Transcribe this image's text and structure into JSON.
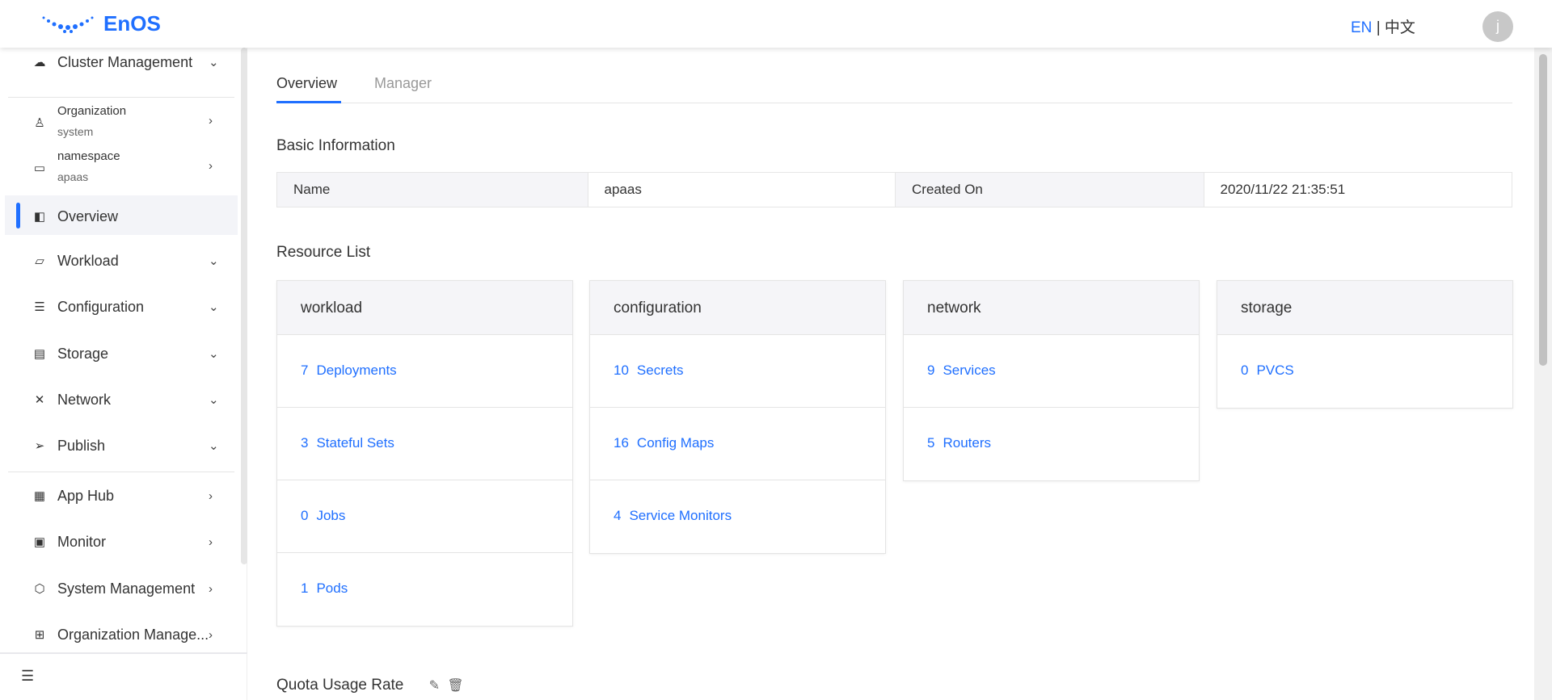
{
  "header": {
    "logo": "EnOS",
    "lang_en": "EN",
    "lang_sep": "|",
    "lang_zh": "中文",
    "avatar": "j"
  },
  "sidebar": {
    "cluster": "Cluster Management",
    "organization": {
      "label": "Organization",
      "value": "system"
    },
    "namespace": {
      "label": "namespace",
      "value": "apaas"
    },
    "items": [
      {
        "label": "Overview"
      },
      {
        "label": "Workload"
      },
      {
        "label": "Configuration"
      },
      {
        "label": "Storage"
      },
      {
        "label": "Network"
      },
      {
        "label": "Publish"
      },
      {
        "label": "App Hub"
      },
      {
        "label": "Monitor"
      },
      {
        "label": "System Management"
      },
      {
        "label": "Organization Manage..."
      }
    ]
  },
  "tabs": [
    "Overview",
    "Manager"
  ],
  "basic": {
    "title": "Basic Information",
    "name_label": "Name",
    "name": "apaas",
    "created_label": "Created On",
    "created": "2020/11/22 21:35:51"
  },
  "resources": {
    "title": "Resource List",
    "cards": [
      {
        "title": "workload",
        "rows": [
          {
            "n": "7",
            "l": "Deployments"
          },
          {
            "n": "3",
            "l": "Stateful Sets"
          },
          {
            "n": "0",
            "l": "Jobs"
          },
          {
            "n": "1",
            "l": "Pods"
          }
        ]
      },
      {
        "title": "configuration",
        "rows": [
          {
            "n": "10",
            "l": "Secrets"
          },
          {
            "n": "16",
            "l": "Config Maps"
          },
          {
            "n": "4",
            "l": "Service Monitors"
          }
        ]
      },
      {
        "title": "network",
        "rows": [
          {
            "n": "9",
            "l": "Services"
          },
          {
            "n": "5",
            "l": "Routers"
          }
        ]
      },
      {
        "title": "storage",
        "rows": [
          {
            "n": "0",
            "l": "PVCS"
          }
        ]
      }
    ]
  },
  "quota": {
    "title": "Quota Usage Rate"
  },
  "colors": {
    "accent": "#1f6fff"
  }
}
